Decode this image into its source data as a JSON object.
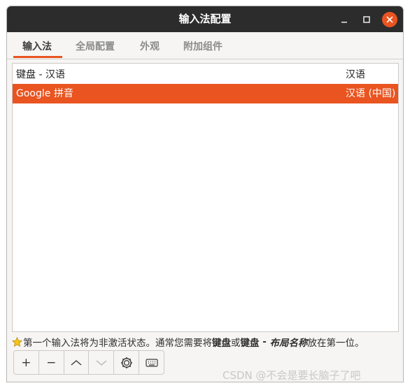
{
  "window": {
    "title": "输入法配置"
  },
  "tabs": [
    {
      "label": "输入法",
      "active": true
    },
    {
      "label": "全局配置",
      "active": false
    },
    {
      "label": "外观",
      "active": false
    },
    {
      "label": "附加组件",
      "active": false
    }
  ],
  "list": {
    "rows": [
      {
        "name": "键盘 - 汉语",
        "lang": "汉语",
        "selected": false
      },
      {
        "name": "Google 拼音",
        "lang": "汉语 (中国)",
        "selected": true
      }
    ]
  },
  "hint": {
    "prefix": "第一个输入法将为非激活状态。通常您需要将",
    "bold1": "键盘",
    "mid": "或",
    "bold2": "键盘",
    "dash": " - ",
    "italic": "布局名称",
    "suffix": "放在第一位。"
  },
  "toolbar": [
    {
      "icon": "add-icon",
      "glyph": "+"
    },
    {
      "icon": "remove-icon",
      "glyph": "−"
    },
    {
      "icon": "move-up-icon",
      "glyph": "︿"
    },
    {
      "icon": "move-down-icon",
      "glyph": "﹀"
    },
    {
      "icon": "configure-icon",
      "glyph": "⚙"
    },
    {
      "icon": "keyboard-layout-icon",
      "glyph": "⌨"
    }
  ],
  "watermark": "CSDN @不会是要长脑子了吧",
  "colors": {
    "accent": "#e95420",
    "titlebar": "#2c2c2c"
  }
}
